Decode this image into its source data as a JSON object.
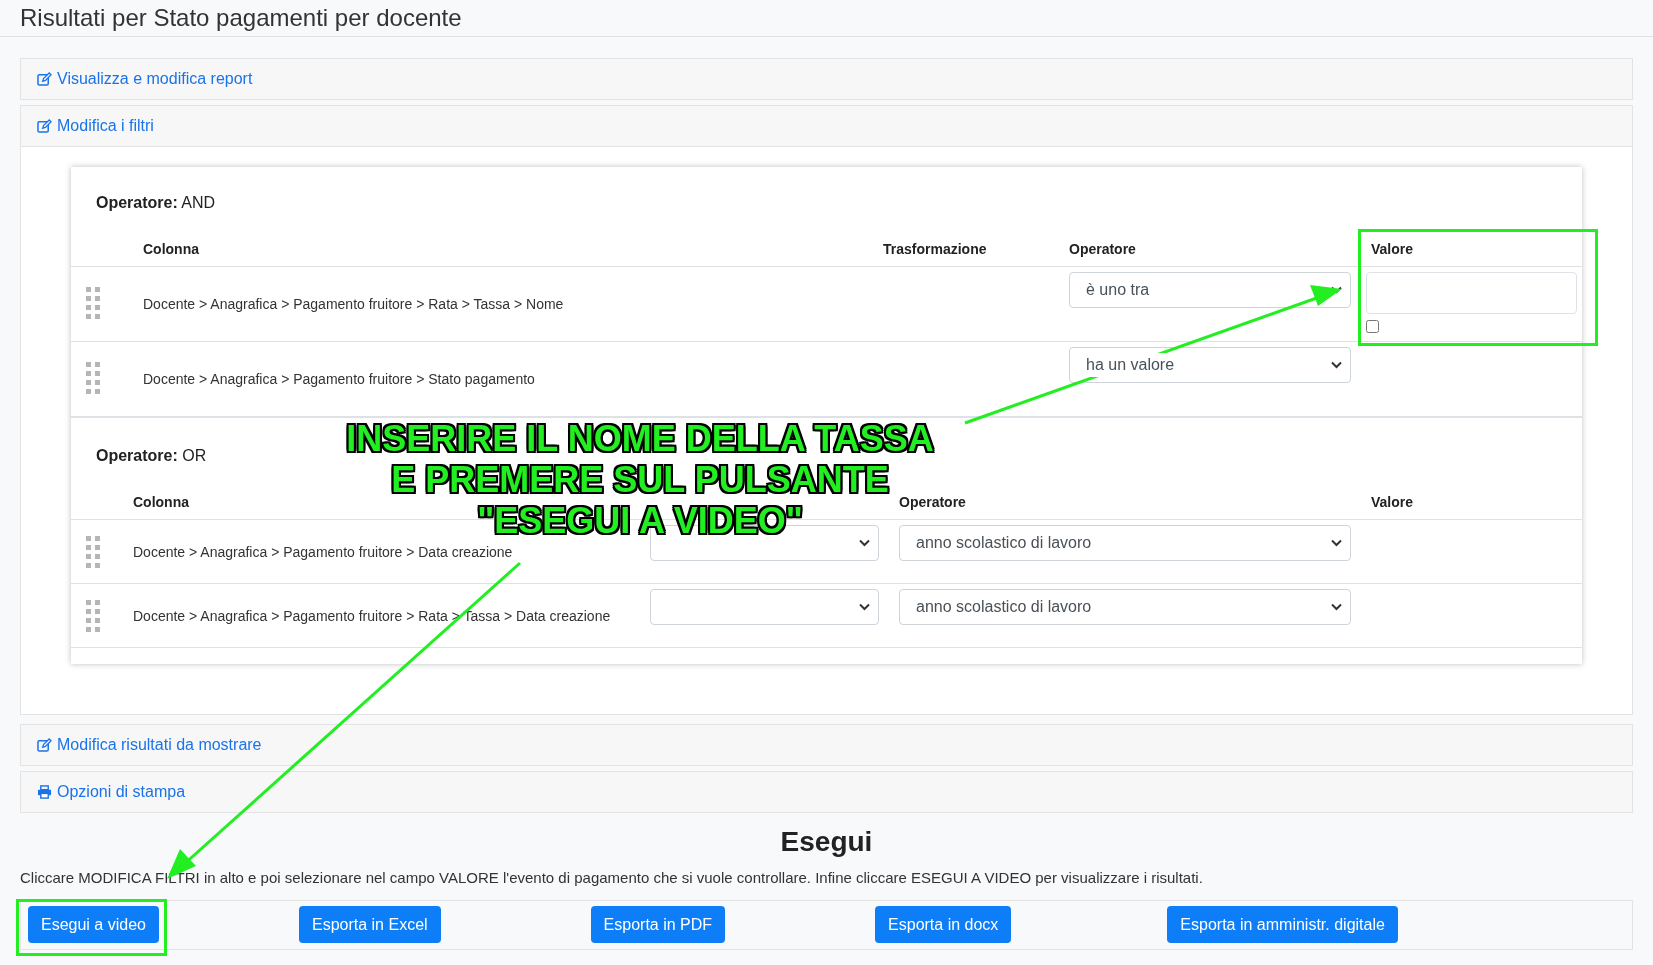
{
  "page_title": "Risultati per Stato pagamenti per docente",
  "panels_top": [
    {
      "label": "Visualizza e modifica report",
      "kind": "edit"
    },
    {
      "label": "Modifica i filtri",
      "kind": "edit"
    }
  ],
  "filters": {
    "groups": [
      {
        "operator_label": "Operatore:",
        "operator": "AND",
        "transform_selects": false,
        "columns": [
          {
            "kind": "path",
            "label": "Colonna"
          },
          {
            "kind": "transform",
            "label": "Trasformazione"
          },
          {
            "kind": "operator",
            "label": "Operatore"
          },
          {
            "kind": "value",
            "label": "Valore"
          }
        ],
        "rows": [
          {
            "path": "Docente > Anagrafica > Pagamento fruitore > Rata > Tassa > Nome",
            "operator": "è uno tra",
            "kind": "value-input",
            "checked": false
          },
          {
            "path": "Docente > Anagrafica > Pagamento fruitore > Stato pagamento",
            "operator": "ha un valore",
            "kind": "plain"
          }
        ]
      },
      {
        "operator_label": "Operatore:",
        "operator": "OR",
        "transform_selects": true,
        "columns": [
          {
            "kind": "path",
            "label": "Colonna"
          },
          {
            "kind": "operator",
            "label": "Operatore"
          },
          {
            "kind": "value",
            "label": "Valore"
          }
        ],
        "rows": [
          {
            "path": "Docente > Anagrafica > Pagamento fruitore > Data creazione",
            "operator": "anno scolastico di lavoro",
            "kind": "plain"
          },
          {
            "path": "Docente > Anagrafica > Pagamento fruitore > Rata > Tassa > Data creazione",
            "operator": "anno scolastico di lavoro",
            "kind": "plain"
          }
        ]
      }
    ]
  },
  "panels_bottom": [
    {
      "label": "Modifica risultati da mostrare",
      "kind": "edit"
    },
    {
      "label": "Opzioni di stampa",
      "kind": "print"
    }
  ],
  "run": {
    "heading": "Esegui",
    "instructions": "Cliccare MODIFICA FILTRI in alto e poi selezionare nel campo VALORE l'evento di pagamento che si vuole controllare. Infine cliccare ESEGUI A VIDEO per visualizzare i risultati.",
    "buttons": [
      "Esegui a video",
      "Esporta in Excel",
      "Esporta in PDF",
      "Esporta in docx",
      "Esporta in amministr. digitale"
    ]
  },
  "annotation": {
    "lines": [
      "INSERIRE IL NOME DELLA TASSA",
      "E PREMERE SUL PULSANTE",
      "\"ESEGUI A VIDEO\""
    ]
  }
}
